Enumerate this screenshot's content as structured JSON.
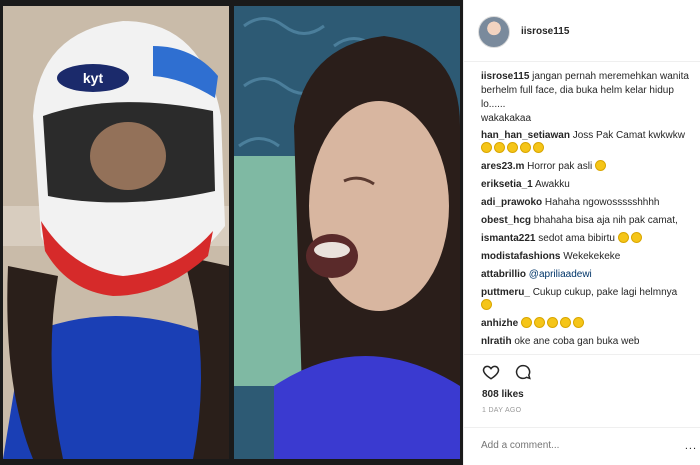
{
  "post": {
    "username": "iisrose115",
    "photo_left_label": "Girl wearing full-face helmet",
    "photo_right_label": "Girl sleeping with mouth open"
  },
  "caption": {
    "user": "iisrose115",
    "text": "jangan pernah meremehkan wanita berhelm full face, dia buka helm kelar hidup lo......",
    "text2": "wakakakaa"
  },
  "comments": [
    {
      "user": "han_han_setiawan",
      "text": "Joss Pak Camat kwkwkw",
      "emojis": 5
    },
    {
      "user": "ares23.m",
      "text": "Horror pak asli",
      "emojis": 1
    },
    {
      "user": "eriksetia_1",
      "text": "Awakku",
      "emojis": 0
    },
    {
      "user": "adi_prawoko",
      "text": "Hahaha ngowossssshhhh",
      "emojis": 0
    },
    {
      "user": "obest_hcg",
      "text": "bhahaha bisa aja nih pak camat,",
      "emojis": 0
    },
    {
      "user": "ismanta221",
      "text": "sedot ama bibirtu",
      "emojis": 2
    },
    {
      "user": "modistafashions",
      "text": "Wekekekeke",
      "emojis": 0
    },
    {
      "user": "attabrillio",
      "text": "@apriliaadewi",
      "emojis": 0
    },
    {
      "user": "puttmeru_",
      "text": "Cukup cukup, pake lagi helmnya",
      "emojis": 1
    },
    {
      "user": "anhizhe",
      "text": "",
      "emojis": 5
    },
    {
      "user": "nlratih",
      "text": "oke ane coba gan buka web",
      "emojis": 0
    }
  ],
  "stats": {
    "likes": "808 likes",
    "time": "1 DAY AGO"
  },
  "add_comment": {
    "placeholder": "Add a comment...",
    "more": "..."
  },
  "icons": {
    "like": "heart-icon",
    "comment": "comment-bubble-icon",
    "more": "more-options-icon"
  }
}
